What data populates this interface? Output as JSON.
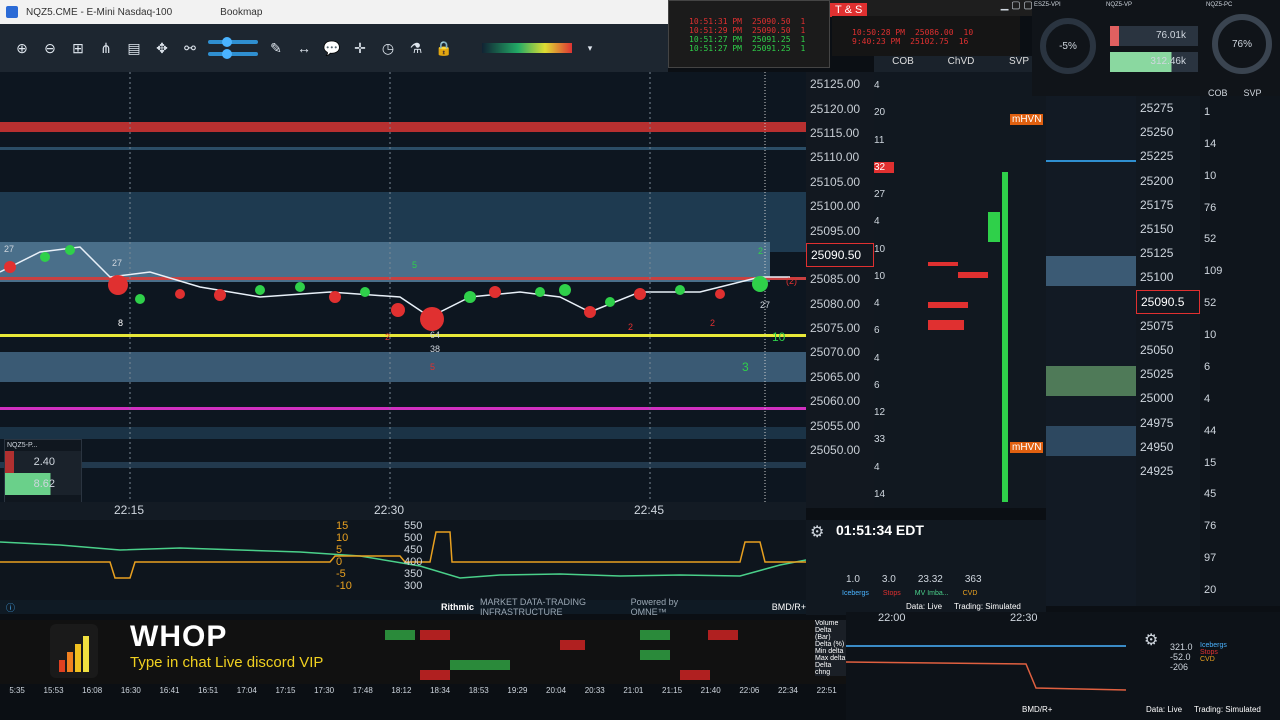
{
  "window": {
    "title": "NQZ5.CME - E-Mini Nasdaq-100",
    "app": "Bookmap"
  },
  "heatmap": {
    "time_labels": [
      "22:15",
      "22:30",
      "22:45"
    ],
    "labels": [
      "27",
      "27",
      "5",
      "8",
      "2",
      "(2)",
      "64",
      "38",
      "5",
      "2",
      "2",
      "2",
      "10",
      "3",
      "27"
    ],
    "mini_panel": {
      "title": "NQZ5-P...",
      "sell": "2.40",
      "buy": "8.62"
    }
  },
  "subchart": {
    "left_labels": [
      "15",
      "10",
      "5",
      "0",
      "-5",
      "-10"
    ],
    "right_labels": [
      "550",
      "500",
      "450",
      "400",
      "350",
      "300"
    ]
  },
  "statusbar": {
    "provider": "Rithmic",
    "tagline": "MARKET DATA-TRADING INFRASTRUCTURE",
    "powered": "Powered by OMNE™",
    "account": "BMD/R+"
  },
  "ladder": {
    "headers": [
      "COB",
      "ChVD",
      "SVP"
    ],
    "prices": [
      "25125.00",
      "25120.00",
      "25115.00",
      "25110.00",
      "25105.00",
      "25100.00",
      "25095.00",
      "25090.50",
      "25085.00",
      "25080.00",
      "25075.00",
      "25070.00",
      "25065.00",
      "25060.00",
      "25055.00",
      "25050.00"
    ],
    "current_price": "25090.50",
    "cob": [
      "4",
      "20",
      "11",
      "32",
      "27",
      "4",
      "10",
      "10",
      "4",
      "6",
      "4",
      "6",
      "12",
      "33",
      "4",
      "14"
    ],
    "mhvn": "mHVN"
  },
  "clock": {
    "time": "01:51:34 EDT",
    "gauges": [
      {
        "value": "1.0",
        "label": "Icebergs"
      },
      {
        "value": "3.0",
        "label": "Stops"
      },
      {
        "value": "23.32",
        "label": "MV Imba..."
      },
      {
        "value": "363",
        "label": "CVD"
      }
    ],
    "data": "Data: Live",
    "trading": "Trading: Simulated"
  },
  "ts": {
    "title": "T & S",
    "rows": [
      {
        "time": "10:51:31 PM",
        "price": "25090.50",
        "size": "1"
      },
      {
        "time": "10:51:29 PM",
        "price": "25090.50",
        "size": "1"
      },
      {
        "time": "10:51:27 PM",
        "price": "25091.25",
        "size": "1"
      },
      {
        "time": "10:51:27 PM",
        "price": "25091.25",
        "size": "1"
      }
    ],
    "rows2": [
      {
        "time": "10:50:28 PM",
        "price": "25086.00",
        "size": "10"
      },
      {
        "time": "9:40:23 PM",
        "price": "25102.75",
        "size": "16"
      }
    ]
  },
  "vpi": [
    {
      "title": "ESZ5-VPI",
      "value": "-5%"
    },
    {
      "title": "NQZ5-VP",
      "sell": "76.01k",
      "buy": "312.46k"
    },
    {
      "title": "NQZ5-PC",
      "value": "76%"
    }
  ],
  "right": {
    "headers": [
      "COB",
      "SVP"
    ],
    "prices": [
      "25275",
      "25250",
      "25225",
      "25200",
      "25175",
      "25150",
      "25125",
      "25100",
      "25090.5",
      "25075",
      "25050",
      "25025",
      "25000",
      "24975",
      "24950",
      "24925"
    ],
    "vols": [
      "1",
      "14",
      "10",
      "76",
      "52",
      "109",
      "52",
      "10",
      "6",
      "4",
      "44",
      "15",
      "45",
      "76",
      "97",
      "20"
    ],
    "times": [
      "22:00",
      "22:30"
    ],
    "stats": [
      "321.0",
      "-52.0",
      "-206"
    ],
    "stat_labels": [
      "Icebergs",
      "Stops",
      "CVD"
    ],
    "data": "Data: Live",
    "trading": "Trading: Simulated",
    "account": "BMD/R+"
  },
  "delta": {
    "row_labels": [
      "Volume",
      "Delta (Bar)",
      "Delta (%)",
      "Min delta",
      "Max delta",
      "Delta chng"
    ],
    "times": [
      "5:35",
      "15:53",
      "16:08",
      "16:30",
      "16:41",
      "16:51",
      "17:04",
      "17:15",
      "17:30",
      "17:48",
      "18:12",
      "18:34",
      "18:53",
      "19:29",
      "20:04",
      "20:33",
      "21:01",
      "21:15",
      "21:40",
      "22:06",
      "22:34",
      "22:51"
    ]
  },
  "overlay": {
    "title": "WHOP",
    "subtitle": "Type in chat Live discord VIP"
  },
  "colors": {
    "sell": "#e03030",
    "buy": "#2fd04a",
    "accent": "#f0c020",
    "magenta": "#d030c0",
    "ladder_bg": "#121820"
  }
}
